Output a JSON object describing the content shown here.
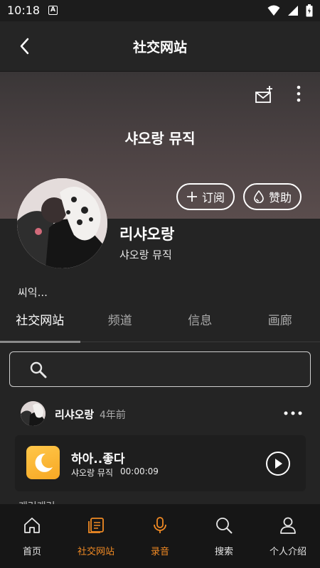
{
  "status_bar": {
    "time": "10:18",
    "notif_letter": "A"
  },
  "app_bar": {
    "title": "社交网站"
  },
  "banner": {
    "title": "샤오랑 뮤직"
  },
  "actions": {
    "subscribe_label": "订阅",
    "donate_label": "赞助"
  },
  "profile": {
    "name": "리샤오랑",
    "subtitle": "샤오랑 뮤직",
    "bio": "씨익..."
  },
  "tabs": [
    {
      "label": "社交网站",
      "active": true
    },
    {
      "label": "频道",
      "active": false
    },
    {
      "label": "信息",
      "active": false
    },
    {
      "label": "画廊",
      "active": false
    }
  ],
  "search": {
    "placeholder": ""
  },
  "post": {
    "author": "리샤오랑",
    "time": "4年前",
    "track": {
      "title": "하아..좋다",
      "artist": "샤오랑 뮤직",
      "duration": "00:00:09"
    },
    "next_text": "개러개러"
  },
  "bottom_nav": [
    {
      "label": "首页",
      "icon": "home-icon",
      "active": false
    },
    {
      "label": "社交网站",
      "icon": "posts-icon",
      "active": true
    },
    {
      "label": "录音",
      "icon": "microphone-icon",
      "active": false
    },
    {
      "label": "搜索",
      "icon": "search-icon",
      "active": false
    },
    {
      "label": "个人介绍",
      "icon": "person-icon",
      "active": false
    }
  ],
  "colors": {
    "accent": "#f08a24",
    "background": "#242424",
    "nav_background": "#161616"
  }
}
